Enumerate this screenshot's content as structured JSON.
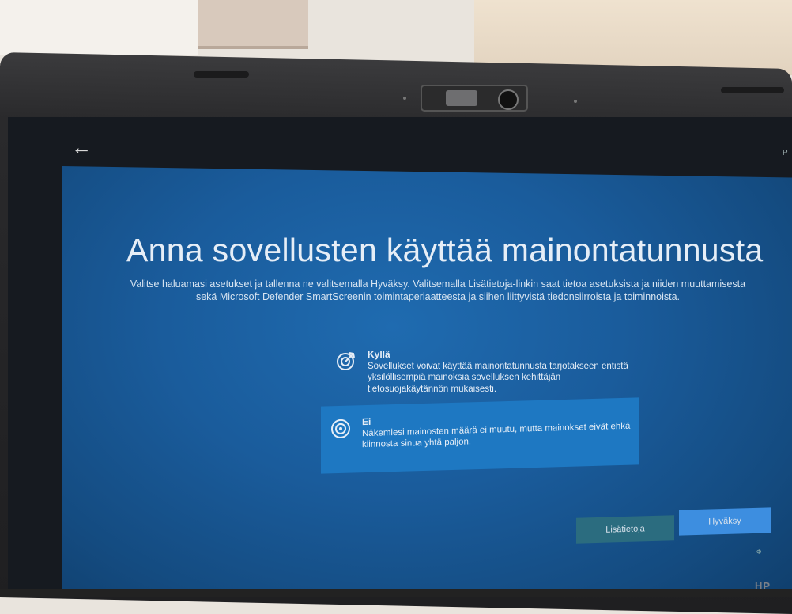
{
  "screen": {
    "title": "Anna sovellusten käyttää mainontatunnusta",
    "description_line1": "Valitse haluamasi asetukset ja tallenna ne valitsemalla Hyväksy. Valitsemalla Lisätietoja-linkin saat tietoa asetuksista ja niiden muuttamisesta",
    "description_line2": "sekä Microsoft Defender SmartScreenin toimintaperiaatteesta ja siihen liittyvistä tiedonsiirroista ja toiminnoista.",
    "options": [
      {
        "label": "Kyllä",
        "text": "Sovellukset voivat käyttää mainontatunnusta tarjotakseen entistä yksilöllisempiä mainoksia sovelluksen kehittäjän tietosuojakäytännön mukaisesti.",
        "selected": false,
        "icon": "target-arrow-icon"
      },
      {
        "label": "Ei",
        "text": "Näkemiesi mainosten määrä ei muutu, mutta mainokset eivät ehkä kiinnosta sinua yhtä paljon.",
        "selected": true,
        "icon": "target-icon"
      }
    ],
    "buttons": {
      "info": "Lisätietoja",
      "accept": "Hyväksy"
    },
    "back_icon": "back-arrow-icon",
    "volume_indicator": "Φ",
    "corner_char": "P"
  },
  "colors": {
    "panel_blue": "#1a5c9c",
    "selected_option": "#1e78c2",
    "accept_button": "#3d8ee0",
    "info_button": "#2b6c7f"
  },
  "device": {
    "brand_mark": "HP"
  }
}
